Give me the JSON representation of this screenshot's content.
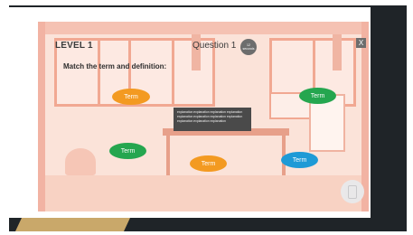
{
  "hud": {
    "level": "LEVEL 1",
    "question": "Question 1",
    "timer_value": "12",
    "timer_unit": "seconds",
    "close_label": "X"
  },
  "instruction": "Match the term and definition:",
  "terms": [
    {
      "label": "Term",
      "color": "#f39a21"
    },
    {
      "label": "Term",
      "color": "#25a64f"
    },
    {
      "label": "Term",
      "color": "#25a64f"
    },
    {
      "label": "Term",
      "color": "#f39a21"
    },
    {
      "label": "Term",
      "color": "#1e9ad6"
    }
  ],
  "definition": {
    "text": "explanation explanation explanation explanation explanation explanation explanation explanation explanation explanation explanation"
  },
  "icons": {
    "phone": "phone-rotate-icon"
  },
  "colors": {
    "accent_orange": "#f39a21",
    "accent_green": "#25a64f",
    "accent_blue": "#1e9ad6",
    "hud_gray": "#6d6d6d"
  }
}
